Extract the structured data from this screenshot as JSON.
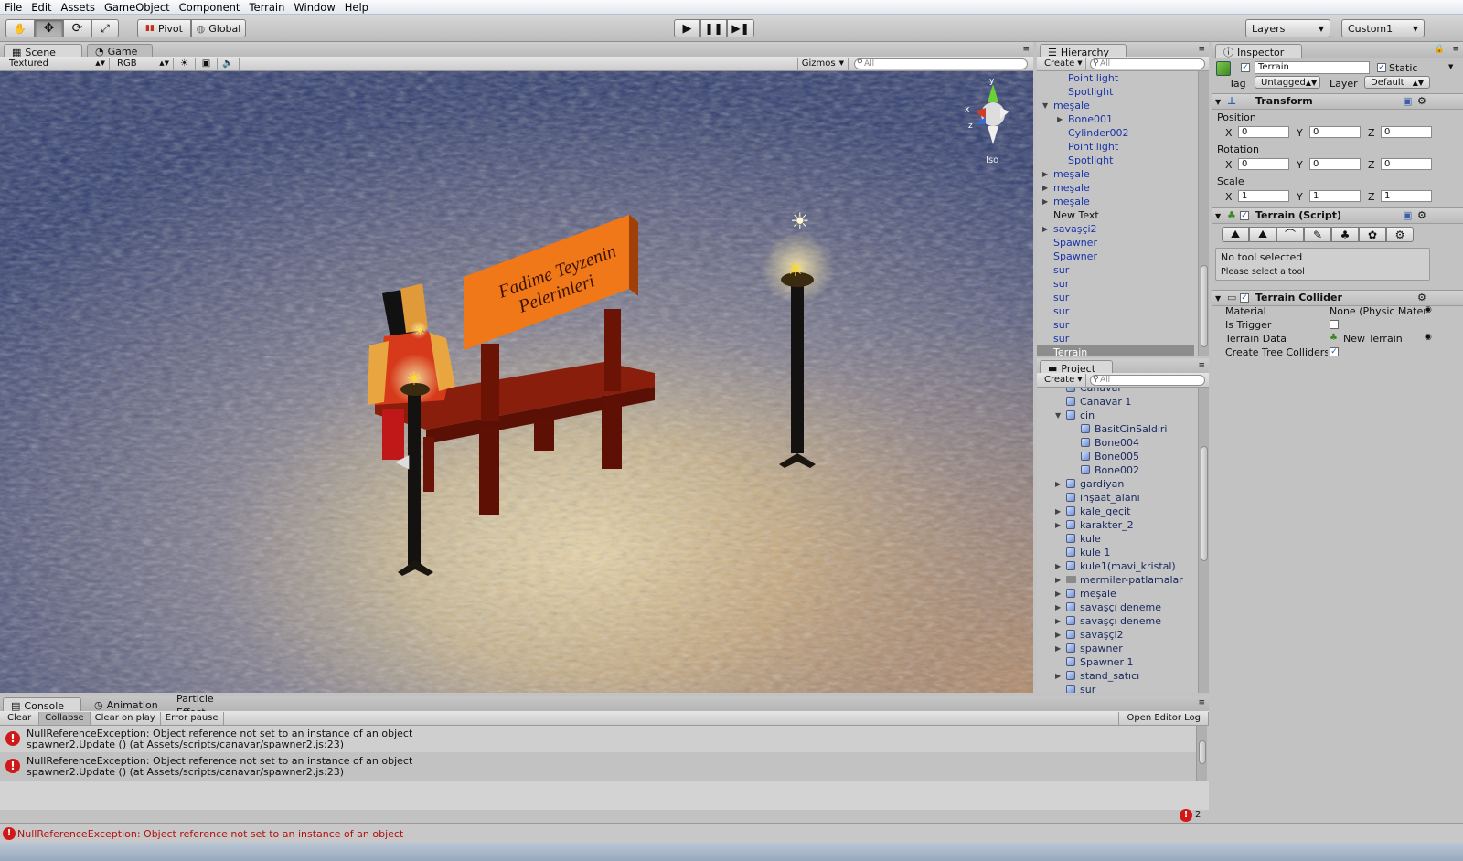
{
  "menu": [
    "File",
    "Edit",
    "Assets",
    "GameObject",
    "Component",
    "Terrain",
    "Window",
    "Help"
  ],
  "toolbar": {
    "pivot": "Pivot",
    "global": "Global",
    "layers": "Layers",
    "layout": "Custom1"
  },
  "scene_panel": {
    "tabs": [
      "Scene",
      "Game"
    ],
    "render_mode": "Textured",
    "color_mode": "RGB",
    "gizmos": "Gizmos",
    "search_placeholder": "All",
    "gizmo_label": "Iso",
    "sign_line1": "Fadime Teyzenin",
    "sign_line2": "Pelerinleri"
  },
  "hierarchy": {
    "title": "Hierarchy",
    "create": "Create",
    "search_placeholder": "All",
    "items": [
      {
        "label": "Point light",
        "indent": 2,
        "arrow": "",
        "color": "blue"
      },
      {
        "label": "Spotlight",
        "indent": 2,
        "arrow": "",
        "color": "blue"
      },
      {
        "label": "meşale",
        "indent": 1,
        "arrow": "down",
        "color": "blue"
      },
      {
        "label": "Bone001",
        "indent": 2,
        "arrow": "right",
        "color": "blue"
      },
      {
        "label": "Cylinder002",
        "indent": 2,
        "arrow": "",
        "color": "blue"
      },
      {
        "label": "Point light",
        "indent": 2,
        "arrow": "",
        "color": "blue"
      },
      {
        "label": "Spotlight",
        "indent": 2,
        "arrow": "",
        "color": "blue"
      },
      {
        "label": "meşale",
        "indent": 1,
        "arrow": "right",
        "color": "blue"
      },
      {
        "label": "meşale",
        "indent": 1,
        "arrow": "right",
        "color": "blue"
      },
      {
        "label": "meşale",
        "indent": 1,
        "arrow": "right",
        "color": "blue"
      },
      {
        "label": "New Text",
        "indent": 1,
        "arrow": "",
        "color": "black"
      },
      {
        "label": "savaşçi2",
        "indent": 1,
        "arrow": "right",
        "color": "blue"
      },
      {
        "label": "Spawner",
        "indent": 1,
        "arrow": "",
        "color": "blue"
      },
      {
        "label": "Spawner",
        "indent": 1,
        "arrow": "",
        "color": "blue"
      },
      {
        "label": "sur",
        "indent": 1,
        "arrow": "",
        "color": "blue"
      },
      {
        "label": "sur",
        "indent": 1,
        "arrow": "",
        "color": "blue"
      },
      {
        "label": "sur",
        "indent": 1,
        "arrow": "",
        "color": "blue"
      },
      {
        "label": "sur",
        "indent": 1,
        "arrow": "",
        "color": "blue"
      },
      {
        "label": "sur",
        "indent": 1,
        "arrow": "",
        "color": "blue"
      },
      {
        "label": "sur",
        "indent": 1,
        "arrow": "",
        "color": "blue"
      },
      {
        "label": "Terrain",
        "indent": 1,
        "arrow": "",
        "color": "selected"
      }
    ]
  },
  "project": {
    "title": "Project",
    "create": "Create",
    "search_placeholder": "All",
    "items": [
      {
        "label": "Canavar",
        "indent": 1,
        "arrow": "",
        "icon": "cube"
      },
      {
        "label": "Canavar 1",
        "indent": 1,
        "arrow": "",
        "icon": "cube"
      },
      {
        "label": "cin",
        "indent": 1,
        "arrow": "down",
        "icon": "cube"
      },
      {
        "label": "BasitCinSaldiri",
        "indent": 2,
        "arrow": "",
        "icon": "cube"
      },
      {
        "label": "Bone004",
        "indent": 2,
        "arrow": "",
        "icon": "cube"
      },
      {
        "label": "Bone005",
        "indent": 2,
        "arrow": "",
        "icon": "cube"
      },
      {
        "label": "Bone002",
        "indent": 2,
        "arrow": "",
        "icon": "cube"
      },
      {
        "label": "gardiyan",
        "indent": 1,
        "arrow": "right",
        "icon": "cube"
      },
      {
        "label": "inşaat_alanı",
        "indent": 1,
        "arrow": "",
        "icon": "cube"
      },
      {
        "label": "kale_geçit",
        "indent": 1,
        "arrow": "right",
        "icon": "cube"
      },
      {
        "label": "karakter_2",
        "indent": 1,
        "arrow": "right",
        "icon": "cube"
      },
      {
        "label": "kule",
        "indent": 1,
        "arrow": "",
        "icon": "cube"
      },
      {
        "label": "kule 1",
        "indent": 1,
        "arrow": "",
        "icon": "cube"
      },
      {
        "label": "kule1(mavi_kristal)",
        "indent": 1,
        "arrow": "right",
        "icon": "cube"
      },
      {
        "label": "mermiler-patlamalar",
        "indent": 1,
        "arrow": "right",
        "icon": "folder"
      },
      {
        "label": "meşale",
        "indent": 1,
        "arrow": "right",
        "icon": "cube"
      },
      {
        "label": "savaşçı deneme",
        "indent": 1,
        "arrow": "right",
        "icon": "cube"
      },
      {
        "label": "savaşçı deneme",
        "indent": 1,
        "arrow": "right",
        "icon": "cube"
      },
      {
        "label": "savaşçi2",
        "indent": 1,
        "arrow": "right",
        "icon": "cube"
      },
      {
        "label": "spawner",
        "indent": 1,
        "arrow": "right",
        "icon": "cube"
      },
      {
        "label": "Spawner 1",
        "indent": 1,
        "arrow": "",
        "icon": "cube"
      },
      {
        "label": "stand_satıcı",
        "indent": 1,
        "arrow": "right",
        "icon": "cube"
      },
      {
        "label": "sur",
        "indent": 1,
        "arrow": "",
        "icon": "cube"
      }
    ]
  },
  "inspector": {
    "title": "Inspector",
    "object_name": "Terrain",
    "static_label": "Static",
    "tag_label": "Tag",
    "tag_value": "Untagged",
    "layer_label": "Layer",
    "layer_value": "Default",
    "transform": {
      "title": "Transform",
      "position_label": "Position",
      "rotation_label": "Rotation",
      "scale_label": "Scale",
      "axis_x": "X",
      "axis_y": "Y",
      "axis_z": "Z",
      "position": [
        "0",
        "0",
        "0"
      ],
      "rotation": [
        "0",
        "0",
        "0"
      ],
      "scale": [
        "1",
        "1",
        "1"
      ]
    },
    "terrain_script": {
      "title": "Terrain (Script)",
      "info_line1": "No tool selected",
      "info_line2": "Please select a tool"
    },
    "terrain_collider": {
      "title": "Terrain Collider",
      "material_label": "Material",
      "material_value": "None (Physic Mater",
      "trigger_label": "Is Trigger",
      "data_label": "Terrain Data",
      "data_value": "New Terrain",
      "tree_label": "Create Tree Colliders"
    }
  },
  "console": {
    "tabs": [
      "Console",
      "Animation",
      "Particle Effect"
    ],
    "buttons": [
      "Clear",
      "Collapse",
      "Clear on play",
      "Error pause"
    ],
    "open_log": "Open Editor Log",
    "entries": [
      {
        "line1": "NullReferenceException: Object reference not set to an instance of an object",
        "line2": "spawner2.Update () (at Assets/scripts/canavar/spawner2.js:23)"
      },
      {
        "line1": "NullReferenceException: Object reference not set to an instance of an object",
        "line2": "spawner2.Update () (at Assets/scripts/canavar/spawner2.js:23)"
      }
    ],
    "error_count": "2"
  },
  "status_bar": {
    "message": "NullReferenceException: Object reference not set to an instance of an object"
  },
  "colors": {
    "accent_blue": "#1a34a8",
    "error_red": "#d01818",
    "sign_orange": "#f07818",
    "table_red": "#7a1408"
  }
}
